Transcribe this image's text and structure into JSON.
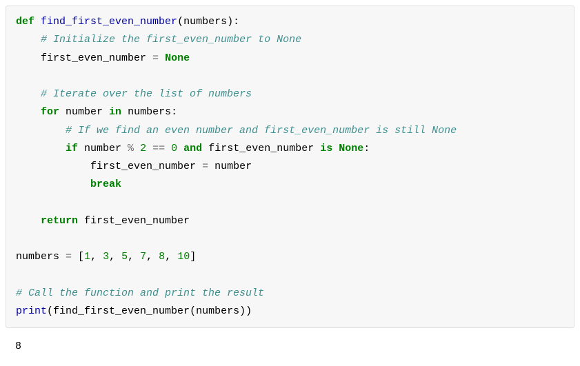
{
  "code": {
    "l1": {
      "kw1": "def",
      "fn": "find_first_even_number",
      "paren_open": "(",
      "param": "numbers",
      "paren_close": "):"
    },
    "l2": {
      "indent": "    ",
      "comment": "# Initialize the first_even_number to None"
    },
    "l3": {
      "indent": "    ",
      "var": "first_even_number ",
      "op": "=",
      "sp": " ",
      "lit": "None"
    },
    "l4": "",
    "l5": {
      "indent": "    ",
      "comment": "# Iterate over the list of numbers"
    },
    "l6": {
      "indent": "    ",
      "kw1": "for",
      "var1": " number ",
      "kw2": "in",
      "var2": " numbers:"
    },
    "l7": {
      "indent": "        ",
      "comment": "# If we find an even number and first_even_number is still None"
    },
    "l8": {
      "indent": "        ",
      "kw1": "if",
      "seg1": " number ",
      "op1": "%",
      "sp1": " ",
      "num1": "2",
      "sp2": " ",
      "op2": "==",
      "sp3": " ",
      "num2": "0",
      "sp4": " ",
      "kw2": "and",
      "seg2": " first_even_number ",
      "kw3": "is",
      "sp5": " ",
      "lit": "None",
      "colon": ":"
    },
    "l9": {
      "indent": "            ",
      "var": "first_even_number ",
      "op": "=",
      "rest": " number"
    },
    "l10": {
      "indent": "            ",
      "kw": "break"
    },
    "l11": "",
    "l12": {
      "indent": "    ",
      "kw": "return",
      "rest": " first_even_number"
    },
    "l13": "",
    "l14": {
      "var": "numbers ",
      "op": "=",
      "sp": " [",
      "n1": "1",
      "c1": ", ",
      "n2": "3",
      "c2": ", ",
      "n3": "5",
      "c3": ", ",
      "n4": "7",
      "c4": ", ",
      "n5": "8",
      "c5": ", ",
      "n6": "10",
      "close": "]"
    },
    "l15": "",
    "l16": {
      "comment": "# Call the function and print the result"
    },
    "l17": {
      "fn1": "print",
      "open": "(",
      "fn2": "find_first_even_number",
      "open2": "(",
      "arg": "numbers",
      "close": "))"
    }
  },
  "output": "8"
}
